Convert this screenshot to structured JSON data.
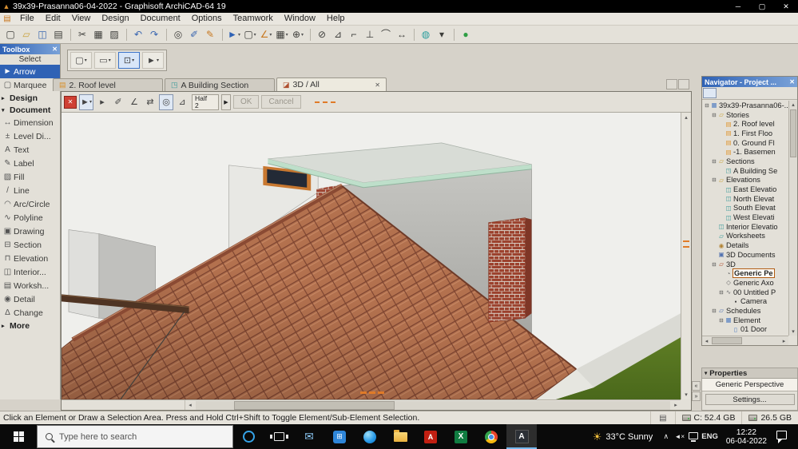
{
  "colors": {
    "sky": "#efefec",
    "roof": "#b3714e",
    "tiledark": "#7c4330",
    "tilelight": "#c98a66",
    "ridge": "#8a4a33",
    "slab": "#d8dcd6",
    "slabedge": "#bedfca",
    "brick": "#9c412d",
    "mortar": "#d8cfc4",
    "grass1": "#5e7d24",
    "grass2": "#4a681b",
    "concrete": "#dadad4",
    "walkway": "#e6e6e0",
    "beam": "#4f3423",
    "accent": "#2f62b5",
    "orange": "#e07b28"
  },
  "ui": {
    "close": "✕",
    "dropdown": "▾",
    "up": "▴",
    "down": "▾",
    "left": "◂",
    "right": "▸",
    "laquo": "«",
    "raquo": "»"
  },
  "titlebar": {
    "title": "39x39-Prasanna06-04-2022 - Graphisoft ArchiCAD-64 19",
    "app_icon": "▲",
    "minimize": "─",
    "maximize": "▢",
    "close": "✕"
  },
  "menu": {
    "icon_glyph": "▤",
    "items": [
      "File",
      "Edit",
      "View",
      "Design",
      "Document",
      "Options",
      "Teamwork",
      "Window",
      "Help"
    ]
  },
  "toolbar": {
    "items": [
      {
        "name": "new-file-icon",
        "glyph": "▢"
      },
      {
        "name": "open-file-icon",
        "glyph": "▱",
        "color": "#c9a23c"
      },
      {
        "name": "save-icon",
        "glyph": "◫",
        "color": "#3a66b0"
      },
      {
        "name": "print-icon",
        "glyph": "▤"
      },
      {
        "type": "sep",
        "inter": false
      },
      {
        "name": "cut-icon",
        "glyph": "✂"
      },
      {
        "name": "copy-icon",
        "glyph": "▦"
      },
      {
        "name": "paste-icon",
        "glyph": "▨"
      },
      {
        "type": "sep",
        "inter": false
      },
      {
        "name": "undo-icon",
        "glyph": "↶",
        "color": "#3a66b0"
      },
      {
        "name": "redo-icon",
        "glyph": "↷",
        "color": "#3a66b0"
      },
      {
        "type": "sep",
        "inter": false
      },
      {
        "name": "find-select-icon",
        "glyph": "◎"
      },
      {
        "name": "pick-up-parameters-icon",
        "glyph": "✐",
        "color": "#3a66b0"
      },
      {
        "name": "inject-parameters-icon",
        "glyph": "✎",
        "color": "#c87820"
      },
      {
        "type": "sep",
        "inter": false
      },
      {
        "name": "arrow-tool-icon",
        "glyph": "►",
        "color": "#2f62b5",
        "dd": "▾"
      },
      {
        "name": "marquee-tool-icon",
        "glyph": "▢",
        "dd": "▾"
      },
      {
        "name": "snap-guides-icon",
        "glyph": "∠",
        "color": "#c87820",
        "dd": "▾"
      },
      {
        "name": "snap-grid-icon",
        "glyph": "▦",
        "dd": "▾"
      },
      {
        "name": "gravity-icon",
        "glyph": "⊕",
        "dd": "▾"
      },
      {
        "type": "sep",
        "inter": false
      },
      {
        "name": "suspend-groups-icon",
        "glyph": "⊘"
      },
      {
        "name": "trim-icon",
        "glyph": "⊿"
      },
      {
        "name": "split-icon",
        "glyph": "⌐"
      },
      {
        "name": "adjust-icon",
        "glyph": "⊥"
      },
      {
        "name": "fillet-icon",
        "glyph": "⌒"
      },
      {
        "name": "stretch-icon",
        "glyph": "↔"
      },
      {
        "type": "sep",
        "inter": false
      },
      {
        "name": "layers-icon",
        "glyph": "◍",
        "color": "#2a9d9d"
      },
      {
        "name": "more-options-icon",
        "glyph": "▾"
      },
      {
        "type": "sep",
        "inter": false
      },
      {
        "name": "teamwork-online-icon",
        "glyph": "●",
        "color": "#2f9e44"
      }
    ]
  },
  "minibar": {
    "items": [
      {
        "name": "marquee-mode-button",
        "glyph": "▢",
        "dd": "▾"
      },
      {
        "name": "drag-mode-button",
        "glyph": "▭",
        "dd": "▾"
      },
      {
        "name": "subelement-mode-button",
        "glyph": "⊡",
        "dd": "▾",
        "selected": true
      },
      {
        "name": "arrow-mode-button",
        "glyph": "►",
        "dd": "▾"
      }
    ]
  },
  "toolbox": {
    "title": "Toolbox",
    "rows": [
      {
        "type": "label",
        "label": "Select",
        "name": "toolbox-section-select",
        "inter": false
      },
      {
        "type": "tool",
        "label": "Arrow",
        "glyph": "►",
        "selected": true,
        "name": "tool-arrow"
      },
      {
        "type": "tool",
        "label": "Marquee",
        "glyph": "▢",
        "name": "tool-marquee"
      },
      {
        "type": "section",
        "label": "Design",
        "glyph": "▸",
        "name": "toolbox-section-design"
      },
      {
        "type": "section",
        "label": "Document",
        "glyph": "▾",
        "name": "toolbox-section-document"
      },
      {
        "type": "tool",
        "label": "Dimension",
        "glyph": "↔",
        "name": "tool-dimension"
      },
      {
        "type": "tool",
        "label": "Level Di...",
        "glyph": "±",
        "name": "tool-level-dimension"
      },
      {
        "type": "tool",
        "label": "Text",
        "glyph": "A",
        "name": "tool-text"
      },
      {
        "type": "tool",
        "label": "Label",
        "glyph": "✎",
        "name": "tool-label"
      },
      {
        "type": "tool",
        "label": "Fill",
        "glyph": "▨",
        "name": "tool-fill"
      },
      {
        "type": "tool",
        "label": "Line",
        "glyph": "/",
        "name": "tool-line"
      },
      {
        "type": "tool",
        "label": "Arc/Circle",
        "glyph": "◠",
        "name": "tool-arc-circle"
      },
      {
        "type": "tool",
        "label": "Polyline",
        "glyph": "∿",
        "name": "tool-polyline"
      },
      {
        "type": "tool",
        "label": "Drawing",
        "glyph": "▣",
        "name": "tool-drawing"
      },
      {
        "type": "tool",
        "label": "Section",
        "glyph": "⊟",
        "name": "tool-section"
      },
      {
        "type": "tool",
        "label": "Elevation",
        "glyph": "⊓",
        "name": "tool-elevation"
      },
      {
        "type": "tool",
        "label": "Interior...",
        "glyph": "◫",
        "name": "tool-interior-elevation"
      },
      {
        "type": "tool",
        "label": "Worksh...",
        "glyph": "▤",
        "name": "tool-worksheet"
      },
      {
        "type": "tool",
        "label": "Detail",
        "glyph": "◉",
        "name": "tool-detail"
      },
      {
        "type": "tool",
        "label": "Change",
        "glyph": "Δ",
        "name": "tool-change"
      },
      {
        "type": "section",
        "label": "More",
        "glyph": "▸",
        "name": "toolbox-section-more"
      }
    ]
  },
  "tabbar": {
    "tabs": [
      {
        "label": "2. Roof level",
        "glyph": "▤",
        "color": "#d88f2a",
        "name": "tab-roof-level"
      },
      {
        "label": "A Building Section",
        "glyph": "◳",
        "color": "#3a9a9a",
        "name": "tab-building-section"
      },
      {
        "label": "3D / All",
        "glyph": "◪",
        "color": "#b05030",
        "active": true,
        "close": "✕",
        "name": "tab-3d-all"
      }
    ],
    "controls": [
      {
        "name": "new-tab-button",
        "glyph": "⊞"
      },
      {
        "name": "tab-menu-button",
        "glyph": "▾"
      }
    ]
  },
  "viewport": {
    "toolbar_icons": [
      {
        "name": "arrow-select-button",
        "glyph": "►",
        "selected": true,
        "dd": "▾"
      },
      {
        "name": "sub-arrow-icon",
        "glyph": "▸"
      },
      {
        "name": "pen-icon",
        "glyph": "✐"
      },
      {
        "name": "angle-icon",
        "glyph": "∠"
      },
      {
        "name": "transfer-settings-icon",
        "glyph": "⇄"
      },
      {
        "name": "magnet-icon",
        "glyph": "◎",
        "selected": true
      },
      {
        "name": "slope-icon",
        "glyph": "⊿"
      }
    ],
    "half_label": "Half",
    "half_value": "2",
    "expand_glyph": "▶",
    "ok_label": "OK",
    "cancel_label": "Cancel",
    "bottom_icons": [
      {
        "name": "model-view-options-icon",
        "glyph": "▦"
      },
      {
        "name": "3d-styles-icon",
        "glyph": "◉"
      },
      {
        "name": "zoom-in-icon",
        "glyph": "⊕"
      },
      {
        "name": "zoom-out-icon",
        "glyph": "⊖"
      },
      {
        "name": "fit-in-window-icon",
        "glyph": "⊡"
      },
      {
        "name": "pan-icon",
        "glyph": "+"
      },
      {
        "name": "orbit-icon",
        "glyph": "↻"
      },
      {
        "name": "walk-icon",
        "glyph": "►"
      },
      {
        "name": "previous-view-icon",
        "glyph": "◂"
      },
      {
        "name": "next-view-icon",
        "glyph": "▸"
      }
    ]
  },
  "navigator": {
    "title": "Navigator - Project ...",
    "icons": [
      {
        "name": "project-map-icon",
        "glyph": "▤",
        "selected": true
      },
      {
        "name": "view-map-icon",
        "glyph": "◫"
      },
      {
        "name": "layout-book-icon",
        "glyph": "▥"
      },
      {
        "name": "publisher-sets-icon",
        "glyph": "↥"
      },
      {
        "name": "tree-view-icon",
        "glyph": "◨"
      }
    ],
    "tree": [
      {
        "label": "39x39-Prasanna06-...",
        "level": 0,
        "exp": "⊟",
        "glyph": "▦",
        "color": "#4a78c0",
        "name": "tree-project-root"
      },
      {
        "label": "Stories",
        "level": 1,
        "exp": "⊟",
        "glyph": "▱",
        "color": "#c9a23c",
        "name": "tree-stories"
      },
      {
        "label": "2. Roof level",
        "level": 2,
        "glyph": "▤",
        "color": "#e0962f",
        "name": "tree-story-roof"
      },
      {
        "label": "1. First Floo",
        "level": 2,
        "glyph": "▤",
        "color": "#e0962f",
        "name": "tree-story-first"
      },
      {
        "label": "0. Ground Fl",
        "level": 2,
        "glyph": "▤",
        "color": "#e0962f",
        "name": "tree-story-ground"
      },
      {
        "label": "-1. Basemen",
        "level": 2,
        "glyph": "▤",
        "color": "#e0962f",
        "name": "tree-story-basement"
      },
      {
        "label": "Sections",
        "level": 1,
        "exp": "⊟",
        "glyph": "▱",
        "color": "#c9a23c",
        "name": "tree-sections"
      },
      {
        "label": "A Building Se",
        "level": 2,
        "glyph": "◳",
        "color": "#3a9a9a",
        "name": "tree-section-a"
      },
      {
        "label": "Elevations",
        "level": 1,
        "exp": "⊟",
        "glyph": "▱",
        "color": "#c9a23c",
        "name": "tree-elevations"
      },
      {
        "label": "East Elevatio",
        "level": 2,
        "glyph": "◫",
        "color": "#3a9a9a",
        "name": "tree-elevation-east"
      },
      {
        "label": "North Elevat",
        "level": 2,
        "glyph": "◫",
        "color": "#3a9a9a",
        "name": "tree-elevation-north"
      },
      {
        "label": "South Elevat",
        "level": 2,
        "glyph": "◫",
        "color": "#3a9a9a",
        "name": "tree-elevation-south"
      },
      {
        "label": "West Elevati",
        "level": 2,
        "glyph": "◫",
        "color": "#3a9a9a",
        "name": "tree-elevation-west"
      },
      {
        "label": "Interior Elevatio",
        "level": 1,
        "glyph": "◫",
        "color": "#3a9a9a",
        "name": "tree-interior-elevations"
      },
      {
        "label": "Worksheets",
        "level": 1,
        "glyph": "▱",
        "color": "#3a9a9a",
        "name": "tree-worksheets"
      },
      {
        "label": "Details",
        "level": 1,
        "glyph": "◉",
        "color": "#b08030",
        "name": "tree-details"
      },
      {
        "label": "3D Documents",
        "level": 1,
        "glyph": "▣",
        "color": "#5070b0",
        "name": "tree-3d-documents"
      },
      {
        "label": "3D",
        "level": 1,
        "exp": "⊟",
        "glyph": "▱",
        "color": "#b05030",
        "name": "tree-3d"
      },
      {
        "label": "Generic Pe",
        "level": 2,
        "glyph": "◔",
        "color": "#666666",
        "selected": true,
        "name": "tree-generic-perspective"
      },
      {
        "label": "Generic Axo",
        "level": 2,
        "glyph": "◇",
        "color": "#666666",
        "name": "tree-generic-axonometry"
      },
      {
        "label": "00 Untitled P",
        "level": 2,
        "exp": "⊟",
        "glyph": "∿",
        "color": "#777777",
        "name": "tree-untitled-path"
      },
      {
        "label": "Camera",
        "level": 3,
        "glyph": "▪",
        "color": "#333333",
        "name": "tree-camera"
      },
      {
        "label": "Schedules",
        "level": 1,
        "exp": "⊟",
        "glyph": "▱",
        "color": "#5070b0",
        "name": "tree-schedules"
      },
      {
        "label": "Element",
        "level": 2,
        "exp": "⊟",
        "glyph": "▦",
        "color": "#4a78c0",
        "name": "tree-element-schedules"
      },
      {
        "label": "01 Door",
        "level": 3,
        "glyph": "▯",
        "color": "#4a78c0",
        "name": "tree-door-schedule"
      }
    ]
  },
  "properties": {
    "title": "Properties",
    "value": "Generic Perspective",
    "settings_label": "Settings..."
  },
  "statusbar": {
    "message": "Click an Element or Draw a Selection Area. Press and Hold Ctrl+Shift to Toggle Element/Sub-Element Selection.",
    "tray_glyph": "▤",
    "disk_c": "C: 52.4 GB",
    "disk_d": "26.5 GB"
  },
  "taskbar": {
    "search_placeholder": "Type here to search",
    "apps": [
      {
        "name": "cortana-icon",
        "cls": "c-cortana"
      },
      {
        "name": "task-view-icon",
        "cls": "c-taskview"
      },
      {
        "name": "outlook-icon",
        "glyph": "✉",
        "color": "#8ac6f2"
      },
      {
        "name": "store-icon",
        "cls": "c-store",
        "glyph": "⊞"
      },
      {
        "name": "edge-icon",
        "cls": "c-edge"
      },
      {
        "name": "file-explorer-icon",
        "cls": "c-folder"
      },
      {
        "name": "acrobat-icon",
        "cls": "c-pdf",
        "glyph": "A"
      },
      {
        "name": "excel-icon",
        "cls": "c-excel",
        "glyph": "X"
      },
      {
        "name": "chrome-icon",
        "cls": "c-chrome"
      },
      {
        "name": "archicad-icon",
        "cls": "c-archicad",
        "glyph": "A",
        "active": true
      }
    ],
    "weather_glyph": "☀",
    "weather": "33°C Sunny",
    "tray": [
      {
        "name": "hidden-icons-icon",
        "glyph": "∧"
      },
      {
        "name": "volume-muted-icon",
        "cls": "c-vol",
        "glyph": "◄×"
      },
      {
        "name": "network-icon",
        "cls": "c-net"
      },
      {
        "name": "language-indicator",
        "cls": "c-lang",
        "glyph": "ENG"
      }
    ],
    "time": "12:22",
    "date": "06-04-2022"
  }
}
